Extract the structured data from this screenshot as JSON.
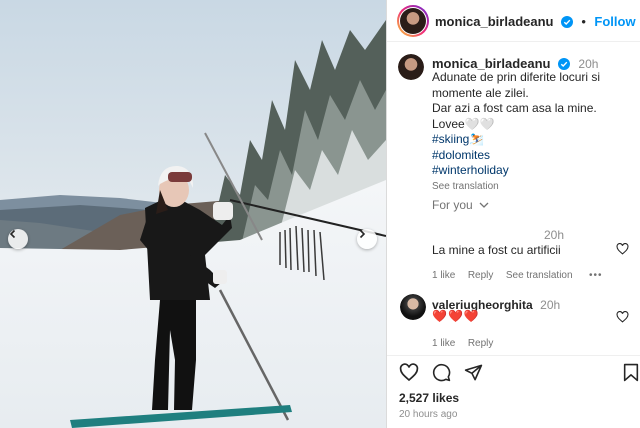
{
  "post": {
    "username": "monica_birladeanu",
    "follow_label": "Follow",
    "separator": "•",
    "caption_time": "20h",
    "caption_lines": [
      "Adunate de prin diferite locuri si",
      "momente ale zilei.",
      "Dar azi a fost cam asa la mine.",
      "Lovee🤍🤍"
    ],
    "hashtags": [
      "#skiing⛷️",
      "#dolomites",
      "#winterholiday"
    ],
    "see_translation": "See translation",
    "for_you_label": "For you"
  },
  "comments": [
    {
      "time": "20h",
      "text": "La mine a fost cu artificii",
      "likes": "1 like",
      "reply": "Reply",
      "see_translation": "See translation",
      "more": "•••"
    },
    {
      "username": "valeriugheorghita",
      "time": "20h",
      "text": "❤️❤️❤️",
      "likes": "1 like",
      "reply": "Reply"
    }
  ],
  "footer": {
    "likes": "2,527 likes",
    "time_ago": "20 hours ago"
  },
  "colors": {
    "link_blue": "#0095f6",
    "hashtag": "#00376b",
    "muted": "#8e8e8e",
    "verified": "#0095f6"
  },
  "icons": [
    "chevron-left-icon",
    "chevron-right-icon",
    "verified-icon",
    "heart-icon",
    "comment-icon",
    "share-icon",
    "bookmark-icon",
    "chevron-down-icon"
  ]
}
